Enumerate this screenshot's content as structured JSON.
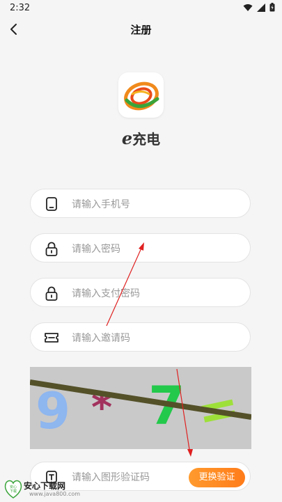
{
  "status_bar": {
    "time": "2:32"
  },
  "nav": {
    "title": "注册"
  },
  "brand": {
    "prefix": "e",
    "name": "充电"
  },
  "fields": [
    {
      "placeholder": "请输入手机号",
      "icon": "phone-icon"
    },
    {
      "placeholder": "请输入密码",
      "icon": "lock-icon"
    },
    {
      "placeholder": "请输入支付密码",
      "icon": "lock-icon"
    },
    {
      "placeholder": "请输入邀请码",
      "icon": "ticket-icon"
    }
  ],
  "captcha": {
    "placeholder": "请输入图形验证码",
    "icon": "text-box-icon",
    "button_label": "更换验证",
    "chars": [
      "9",
      "*",
      "7",
      "="
    ]
  },
  "watermark": {
    "name": "安心下载网",
    "url": "www.java800.com",
    "badge": "安心\n下载"
  },
  "colors": {
    "accent": "#ff8a24",
    "background": "#f5f5f5",
    "annotation_arrow": "#e02020"
  }
}
